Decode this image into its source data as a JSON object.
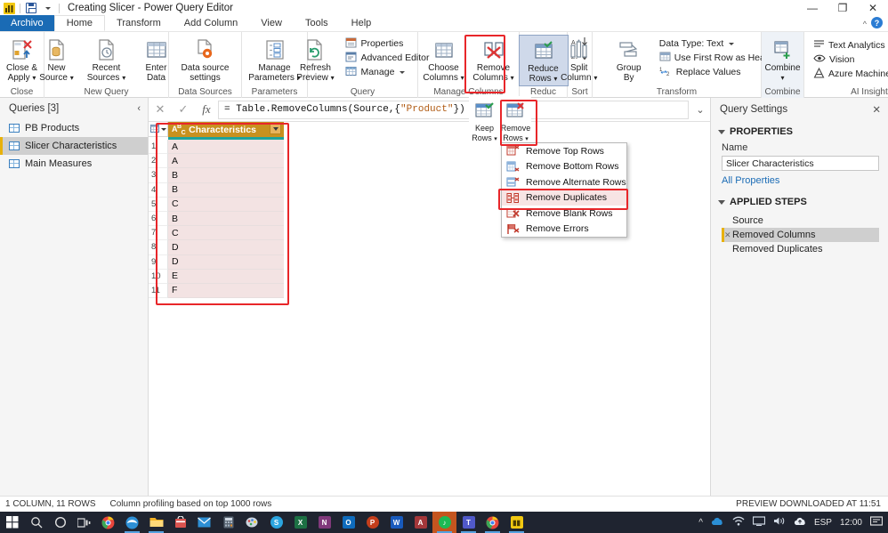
{
  "window": {
    "title": "Creating Slicer - Power Query Editor",
    "minimize": "—",
    "maximize": "❐",
    "close": "✕",
    "help_label": "?"
  },
  "tabs": [
    {
      "label": "Archivo",
      "kind": "file"
    },
    {
      "label": "Home",
      "kind": "active"
    },
    {
      "label": "Transform",
      "kind": "normal"
    },
    {
      "label": "Add Column",
      "kind": "normal"
    },
    {
      "label": "View",
      "kind": "normal"
    },
    {
      "label": "Tools",
      "kind": "normal"
    },
    {
      "label": "Help",
      "kind": "normal"
    }
  ],
  "ribbon": {
    "groups": [
      {
        "label": "Close",
        "buttons": [
          {
            "label": "Close &\nApply",
            "caret": true,
            "icon": "close-apply-icon"
          }
        ]
      },
      {
        "label": "New Query",
        "buttons": [
          {
            "label": "New\nSource",
            "caret": true,
            "icon": "new-source-icon"
          },
          {
            "label": "Recent\nSources",
            "caret": true,
            "icon": "recent-sources-icon"
          },
          {
            "label": "Enter\nData",
            "caret": false,
            "icon": "enter-data-icon"
          }
        ]
      },
      {
        "label": "Data Sources",
        "buttons": [
          {
            "label": "Data source\nsettings",
            "caret": false,
            "icon": "data-source-settings-icon"
          }
        ]
      },
      {
        "label": "Parameters",
        "buttons": [
          {
            "label": "Manage\nParameters",
            "caret": true,
            "icon": "manage-parameters-icon"
          }
        ]
      },
      {
        "label": "Query",
        "buttons": [
          {
            "label": "Refresh\nPreview",
            "caret": true,
            "icon": "refresh-preview-icon"
          }
        ],
        "small": [
          "Properties",
          "Advanced Editor",
          "Manage"
        ]
      },
      {
        "label": "Manage Columns",
        "buttons": [
          {
            "label": "Choose\nColumns",
            "caret": true,
            "icon": "choose-columns-icon"
          },
          {
            "label": "Remove\nColumns",
            "caret": true,
            "icon": "remove-columns-icon"
          }
        ]
      },
      {
        "label": "Reduc",
        "buttons": [
          {
            "label": "Reduce\nRows",
            "caret": true,
            "icon": "reduce-rows-icon"
          }
        ]
      },
      {
        "label": "Sort",
        "buttons": []
      },
      {
        "label": "Transform",
        "buttons": [
          {
            "label": "Split\nColumn",
            "caret": true,
            "icon": "split-column-icon"
          },
          {
            "label": "Group\nBy",
            "caret": false,
            "icon": "group-by-icon"
          }
        ],
        "small": [
          "Data Type: Text",
          "Use First Row as Headers",
          "Replace Values"
        ]
      },
      {
        "label": "Combine",
        "buttons": [
          {
            "label": "Combine",
            "caret": true,
            "icon": "combine-icon"
          }
        ]
      },
      {
        "label": "AI Insights",
        "buttons": [],
        "small": [
          "Text Analytics",
          "Vision",
          "Azure Machine Learning"
        ]
      }
    ]
  },
  "reduce_flyout": {
    "keep_rows": "Keep\nRows",
    "remove_rows": "Remove\nRows"
  },
  "menu": {
    "items": [
      {
        "label": "Remove Top Rows",
        "icon": "remove-top-rows-icon",
        "highlighted": false
      },
      {
        "label": "Remove Bottom Rows",
        "icon": "remove-bottom-rows-icon",
        "highlighted": false
      },
      {
        "label": "Remove Alternate Rows",
        "icon": "remove-alternate-rows-icon",
        "highlighted": false
      },
      {
        "label": "Remove Duplicates",
        "icon": "remove-duplicates-icon",
        "highlighted": true
      },
      {
        "label": "Remove Blank Rows",
        "icon": "remove-blank-rows-icon",
        "highlighted": false
      },
      {
        "label": "Remove Errors",
        "icon": "remove-errors-icon",
        "highlighted": false
      }
    ]
  },
  "queries_pane": {
    "title": "Queries [3]",
    "collapse_icon": "chevron-left-icon",
    "items": [
      {
        "label": "PB Products",
        "selected": false
      },
      {
        "label": "Slicer Characteristics",
        "selected": true
      },
      {
        "label": "Main Measures",
        "selected": false
      }
    ]
  },
  "formula_bar": {
    "cancel": "✕",
    "accept": "✓",
    "fx": "fx",
    "prefix": "= Table.RemoveColumns(Source,{",
    "string_literal": "\"Product\"",
    "suffix": "})",
    "expand": "⌄"
  },
  "grid": {
    "column_header": "Characteristics",
    "type_indicator": "ABC",
    "rows": [
      {
        "n": "1",
        "value": "A"
      },
      {
        "n": "2",
        "value": "A"
      },
      {
        "n": "3",
        "value": "B"
      },
      {
        "n": "4",
        "value": "B"
      },
      {
        "n": "5",
        "value": "C"
      },
      {
        "n": "6",
        "value": "B"
      },
      {
        "n": "7",
        "value": "C"
      },
      {
        "n": "8",
        "value": "D"
      },
      {
        "n": "9",
        "value": "D"
      },
      {
        "n": "10",
        "value": "E"
      },
      {
        "n": "11",
        "value": "F"
      }
    ]
  },
  "query_settings": {
    "title": "Query Settings",
    "close": "✕",
    "properties_label": "PROPERTIES",
    "name_label": "Name",
    "name_value": "Slicer Characteristics",
    "all_properties": "All Properties",
    "applied_steps_label": "APPLIED STEPS",
    "steps": [
      {
        "label": "Source",
        "selected": false,
        "has_gear": false
      },
      {
        "label": "Removed Columns",
        "selected": true,
        "has_gear": true
      },
      {
        "label": "Removed Duplicates",
        "selected": false,
        "has_gear": false
      }
    ]
  },
  "status_bar": {
    "left": "1 COLUMN, 11 ROWS",
    "profiling": "Column profiling based on top 1000 rows",
    "right": "PREVIEW DOWNLOADED AT 11:51"
  },
  "taskbar": {
    "start": "start-icon",
    "search": "search-icon",
    "cortana": "cortana-icon",
    "taskview": "task-view-icon",
    "apps": [
      {
        "name": "chrome-icon",
        "color": "#e8453c",
        "glyph": "",
        "active": false
      },
      {
        "name": "edge-icon",
        "color": "#2d8fd5",
        "glyph": "",
        "active": true
      },
      {
        "name": "file-explorer-icon",
        "color": "#f5b324",
        "glyph": "",
        "active": true
      },
      {
        "name": "microsoft-store-icon",
        "color": "#d9534f",
        "glyph": "",
        "active": false
      },
      {
        "name": "mail-icon",
        "color": "#2d8fd5",
        "glyph": "",
        "active": false
      },
      {
        "name": "calculator-icon",
        "color": "#5a6673",
        "glyph": "",
        "active": false
      },
      {
        "name": "paint-icon",
        "color": "#c94f4f",
        "glyph": "",
        "active": false
      },
      {
        "name": "skype-icon",
        "color": "#2ba5e0",
        "glyph": "S",
        "active": false
      },
      {
        "name": "excel-icon",
        "color": "#1d7044",
        "glyph": "X",
        "active": false
      },
      {
        "name": "onenote-icon",
        "color": "#80397b",
        "glyph": "N",
        "active": false
      },
      {
        "name": "outlook-icon",
        "color": "#0f6cbd",
        "glyph": "O",
        "active": false
      },
      {
        "name": "powerpoint-icon",
        "color": "#c43e1c",
        "glyph": "P",
        "active": false
      },
      {
        "name": "word-icon",
        "color": "#185abd",
        "glyph": "W",
        "active": false
      },
      {
        "name": "access-icon",
        "color": "#a4373a",
        "glyph": "A",
        "active": false
      },
      {
        "name": "spotify-icon",
        "color": "#1db954",
        "glyph": "",
        "active": true
      },
      {
        "name": "teams-icon",
        "color": "#5059c9",
        "glyph": "T",
        "active": true
      },
      {
        "name": "chrome2-icon",
        "color": "#e8453c",
        "glyph": "",
        "active": true
      },
      {
        "name": "power-bi-icon",
        "color": "#f2c811",
        "glyph": "",
        "active": true
      }
    ],
    "tray": {
      "chevron": "^",
      "onedrive": "onedrive-icon",
      "network": "network-icon",
      "display": "display-icon",
      "volume": "volume-icon",
      "cloud": "cloud-icon",
      "language": "ESP",
      "clock": "12:00",
      "notifications": "notification-icon"
    }
  }
}
